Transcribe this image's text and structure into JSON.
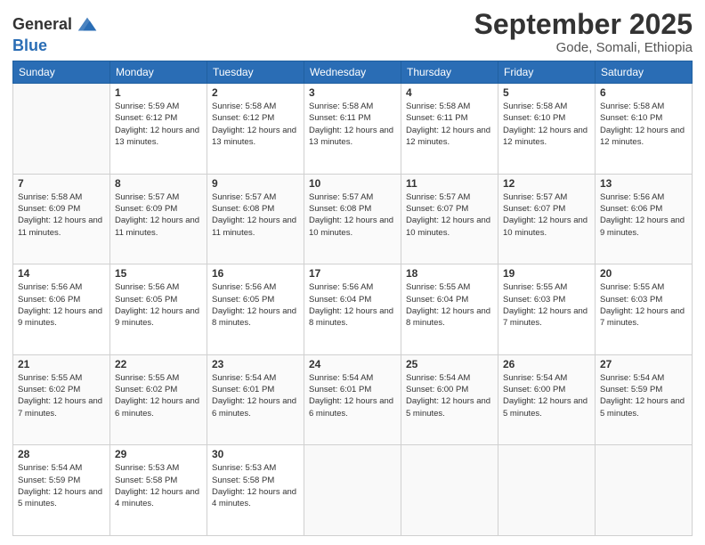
{
  "header": {
    "logo_general": "General",
    "logo_blue": "Blue",
    "month_title": "September 2025",
    "location": "Gode, Somali, Ethiopia"
  },
  "days_of_week": [
    "Sunday",
    "Monday",
    "Tuesday",
    "Wednesday",
    "Thursday",
    "Friday",
    "Saturday"
  ],
  "weeks": [
    [
      {
        "day": "",
        "info": ""
      },
      {
        "day": "1",
        "info": "Sunrise: 5:59 AM\nSunset: 6:12 PM\nDaylight: 12 hours\nand 13 minutes."
      },
      {
        "day": "2",
        "info": "Sunrise: 5:58 AM\nSunset: 6:12 PM\nDaylight: 12 hours\nand 13 minutes."
      },
      {
        "day": "3",
        "info": "Sunrise: 5:58 AM\nSunset: 6:11 PM\nDaylight: 12 hours\nand 13 minutes."
      },
      {
        "day": "4",
        "info": "Sunrise: 5:58 AM\nSunset: 6:11 PM\nDaylight: 12 hours\nand 12 minutes."
      },
      {
        "day": "5",
        "info": "Sunrise: 5:58 AM\nSunset: 6:10 PM\nDaylight: 12 hours\nand 12 minutes."
      },
      {
        "day": "6",
        "info": "Sunrise: 5:58 AM\nSunset: 6:10 PM\nDaylight: 12 hours\nand 12 minutes."
      }
    ],
    [
      {
        "day": "7",
        "info": "Sunrise: 5:58 AM\nSunset: 6:09 PM\nDaylight: 12 hours\nand 11 minutes."
      },
      {
        "day": "8",
        "info": "Sunrise: 5:57 AM\nSunset: 6:09 PM\nDaylight: 12 hours\nand 11 minutes."
      },
      {
        "day": "9",
        "info": "Sunrise: 5:57 AM\nSunset: 6:08 PM\nDaylight: 12 hours\nand 11 minutes."
      },
      {
        "day": "10",
        "info": "Sunrise: 5:57 AM\nSunset: 6:08 PM\nDaylight: 12 hours\nand 10 minutes."
      },
      {
        "day": "11",
        "info": "Sunrise: 5:57 AM\nSunset: 6:07 PM\nDaylight: 12 hours\nand 10 minutes."
      },
      {
        "day": "12",
        "info": "Sunrise: 5:57 AM\nSunset: 6:07 PM\nDaylight: 12 hours\nand 10 minutes."
      },
      {
        "day": "13",
        "info": "Sunrise: 5:56 AM\nSunset: 6:06 PM\nDaylight: 12 hours\nand 9 minutes."
      }
    ],
    [
      {
        "day": "14",
        "info": "Sunrise: 5:56 AM\nSunset: 6:06 PM\nDaylight: 12 hours\nand 9 minutes."
      },
      {
        "day": "15",
        "info": "Sunrise: 5:56 AM\nSunset: 6:05 PM\nDaylight: 12 hours\nand 9 minutes."
      },
      {
        "day": "16",
        "info": "Sunrise: 5:56 AM\nSunset: 6:05 PM\nDaylight: 12 hours\nand 8 minutes."
      },
      {
        "day": "17",
        "info": "Sunrise: 5:56 AM\nSunset: 6:04 PM\nDaylight: 12 hours\nand 8 minutes."
      },
      {
        "day": "18",
        "info": "Sunrise: 5:55 AM\nSunset: 6:04 PM\nDaylight: 12 hours\nand 8 minutes."
      },
      {
        "day": "19",
        "info": "Sunrise: 5:55 AM\nSunset: 6:03 PM\nDaylight: 12 hours\nand 7 minutes."
      },
      {
        "day": "20",
        "info": "Sunrise: 5:55 AM\nSunset: 6:03 PM\nDaylight: 12 hours\nand 7 minutes."
      }
    ],
    [
      {
        "day": "21",
        "info": "Sunrise: 5:55 AM\nSunset: 6:02 PM\nDaylight: 12 hours\nand 7 minutes."
      },
      {
        "day": "22",
        "info": "Sunrise: 5:55 AM\nSunset: 6:02 PM\nDaylight: 12 hours\nand 6 minutes."
      },
      {
        "day": "23",
        "info": "Sunrise: 5:54 AM\nSunset: 6:01 PM\nDaylight: 12 hours\nand 6 minutes."
      },
      {
        "day": "24",
        "info": "Sunrise: 5:54 AM\nSunset: 6:01 PM\nDaylight: 12 hours\nand 6 minutes."
      },
      {
        "day": "25",
        "info": "Sunrise: 5:54 AM\nSunset: 6:00 PM\nDaylight: 12 hours\nand 5 minutes."
      },
      {
        "day": "26",
        "info": "Sunrise: 5:54 AM\nSunset: 6:00 PM\nDaylight: 12 hours\nand 5 minutes."
      },
      {
        "day": "27",
        "info": "Sunrise: 5:54 AM\nSunset: 5:59 PM\nDaylight: 12 hours\nand 5 minutes."
      }
    ],
    [
      {
        "day": "28",
        "info": "Sunrise: 5:54 AM\nSunset: 5:59 PM\nDaylight: 12 hours\nand 5 minutes."
      },
      {
        "day": "29",
        "info": "Sunrise: 5:53 AM\nSunset: 5:58 PM\nDaylight: 12 hours\nand 4 minutes."
      },
      {
        "day": "30",
        "info": "Sunrise: 5:53 AM\nSunset: 5:58 PM\nDaylight: 12 hours\nand 4 minutes."
      },
      {
        "day": "",
        "info": ""
      },
      {
        "day": "",
        "info": ""
      },
      {
        "day": "",
        "info": ""
      },
      {
        "day": "",
        "info": ""
      }
    ]
  ]
}
